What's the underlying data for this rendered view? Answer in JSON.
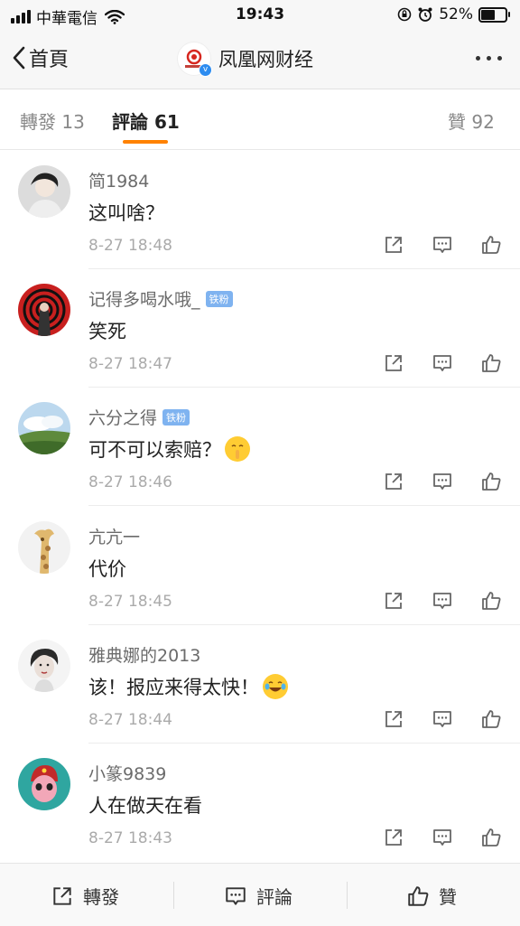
{
  "status_bar": {
    "carrier": "中華電信",
    "time": "19:43",
    "battery": "52%",
    "battery_level": 0.52
  },
  "nav": {
    "back_label": "首頁",
    "title": "凤凰网财经",
    "logo_icon": "ifeng-finance-logo",
    "verified_icon": "verified-badge-icon"
  },
  "tabs": {
    "repost": "轉發 13",
    "comment": "評論 61",
    "like": "贊 92",
    "accent_color": "#ff8200"
  },
  "comments": [
    {
      "name": "简1984",
      "badge": "",
      "text": "这叫啥？",
      "emoji": "",
      "time": "8-27 18:48"
    },
    {
      "name": "记得多喝水哦_",
      "badge": "铁粉",
      "text": "笑死",
      "emoji": "",
      "time": "8-27 18:47"
    },
    {
      "name": "六分之得",
      "badge": "铁粉",
      "text": "可不可以索赔？",
      "emoji": "shushing-face-emoji",
      "time": "8-27 18:46"
    },
    {
      "name": "亢亢一",
      "badge": "",
      "text": "代价",
      "emoji": "",
      "time": "8-27 18:45"
    },
    {
      "name": "雅典娜的2013",
      "badge": "",
      "text": "该！报应来得太快！",
      "emoji": "laughing-tears-emoji",
      "time": "8-27 18:44"
    },
    {
      "name": "小篆9839",
      "badge": "",
      "text": "人在做天在看",
      "emoji": "",
      "time": "8-27 18:43"
    }
  ],
  "bottom_bar": {
    "repost": "轉發",
    "comment": "評論",
    "like": "贊"
  }
}
